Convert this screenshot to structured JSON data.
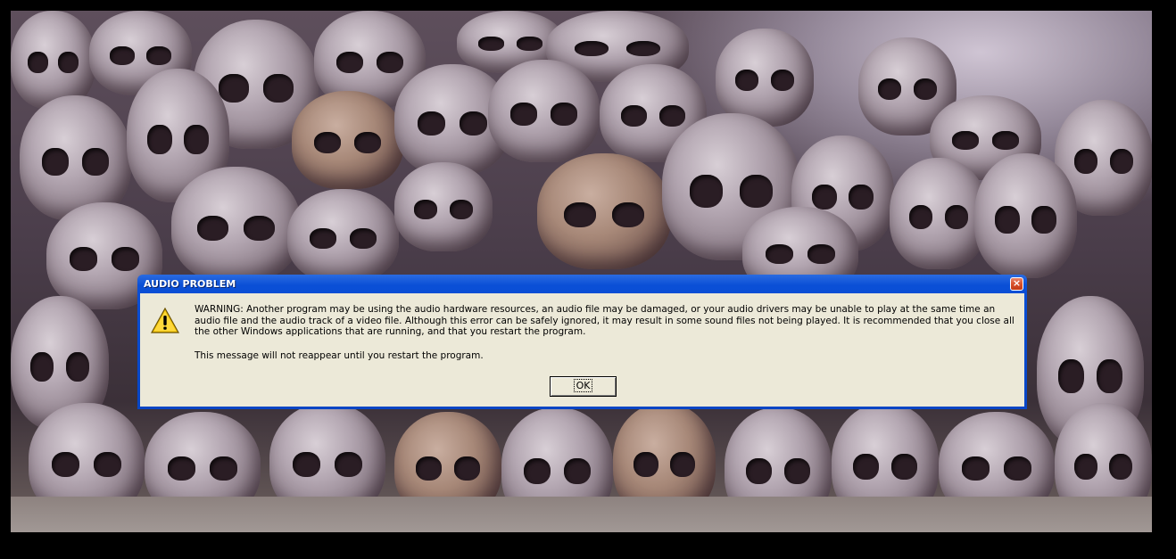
{
  "dialog": {
    "title": "AUDIO PROBLEM",
    "close_label": "×",
    "icon": "warning-icon",
    "message": "WARNING: Another program may be using the audio hardware resources, an audio file may be damaged, or your audio drivers may be unable to play at the same time an audio file and the audio track of a video file. Although this error can be safely ignored, it may result in some sound files not being played. It is recommended that you close all the other Windows applications that are running, and that you restart the program.",
    "note": "This message will not reappear until you restart the program.",
    "ok_label": "OK"
  },
  "colors": {
    "titlebar": "#0845c4",
    "client": "#ece9d8",
    "close": "#d7502b"
  }
}
